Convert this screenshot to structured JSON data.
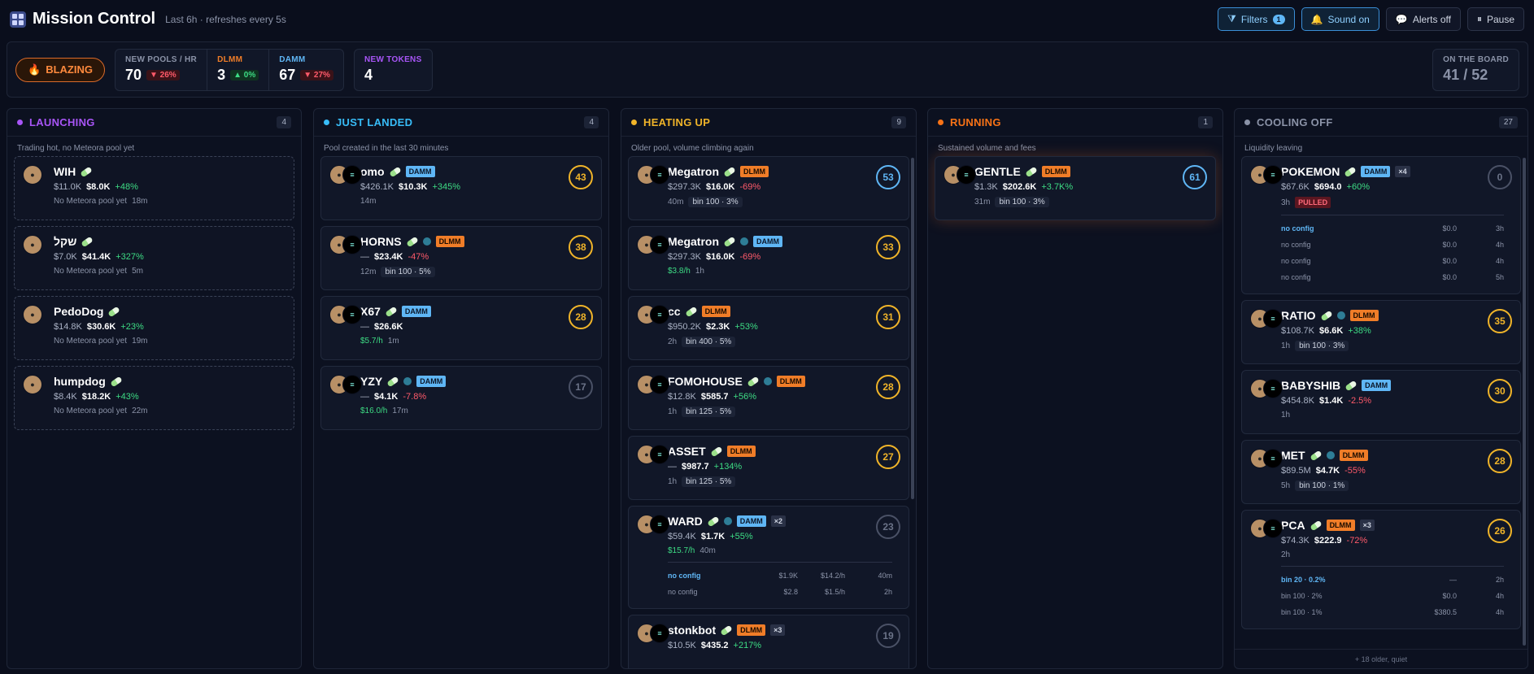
{
  "header": {
    "title": "Mission Control",
    "subtitle": "Last 6h · refreshes every 5s",
    "filters": "Filters",
    "filters_count": "1",
    "sound": "Sound on",
    "alerts": "Alerts off",
    "pause": "Pause"
  },
  "stats": {
    "status": "BLAZING",
    "pools_label": "NEW POOLS / HR",
    "pools_value": "70",
    "pools_delta": "▼ 26%",
    "dlmm_label": "DLMM",
    "dlmm_value": "3",
    "dlmm_delta": "▲ 0%",
    "damm_label": "DAMM",
    "damm_value": "67",
    "damm_delta": "▼ 27%",
    "tokens_label": "NEW TOKENS",
    "tokens_value": "4",
    "board_label": "ON THE BOARD",
    "board_value": "41 / 52"
  },
  "colors": {
    "launching": "#a855f7",
    "landed": "#38bdf8",
    "heating": "#f0b429",
    "running": "#f97316",
    "cooling": "#8b93a8"
  },
  "columns": [
    {
      "key": "launching",
      "title": "LAUNCHING",
      "count": "4",
      "desc": "Trading hot, no Meteora pool yet",
      "cards": [
        {
          "name": "WIH",
          "v1": "$11.0K",
          "v2": "$8.0K",
          "ch": "+48%",
          "meta": "No Meteora pool yet",
          "age": "18m"
        },
        {
          "name": "שקל",
          "v1": "$7.0K",
          "v2": "$41.4K",
          "ch": "+327%",
          "meta": "No Meteora pool yet",
          "age": "5m"
        },
        {
          "name": "PedoDog",
          "v1": "$14.8K",
          "v2": "$30.6K",
          "ch": "+23%",
          "meta": "No Meteora pool yet",
          "age": "19m"
        },
        {
          "name": "humpdog",
          "v1": "$8.4K",
          "v2": "$18.2K",
          "ch": "+43%",
          "meta": "No Meteora pool yet",
          "age": "22m"
        }
      ]
    },
    {
      "key": "landed",
      "title": "JUST LANDED",
      "count": "4",
      "desc": "Pool created in the last 30 minutes",
      "cards": [
        {
          "name": "omo",
          "badge": "DAMM",
          "v1": "$426.1K",
          "v2": "$10.3K",
          "ch": "+345%",
          "age": "14m",
          "score": "43"
        },
        {
          "name": "HORNS",
          "badge": "DLMM",
          "v1": "—",
          "v2": "$23.4K",
          "ch": "-47%",
          "age": "12m",
          "tag": "bin 100 · 5%",
          "score": "38"
        },
        {
          "name": "X67",
          "badge": "DAMM",
          "v1": "—",
          "v2": "$26.6K",
          "rate": "$5.7/h",
          "age": "1m",
          "score": "28"
        },
        {
          "name": "YZY",
          "badge": "DAMM",
          "v1": "—",
          "v2": "$4.1K",
          "ch": "-7.8%",
          "rate": "$16.0/h",
          "age": "17m",
          "score": "17"
        }
      ]
    },
    {
      "key": "heating",
      "title": "HEATING UP",
      "count": "9",
      "desc": "Older pool, volume climbing again",
      "cards": [
        {
          "name": "Megatron",
          "badge": "DLMM",
          "v1": "$297.3K",
          "v2": "$16.0K",
          "ch": "-69%",
          "age": "40m",
          "tag": "bin 100 · 3%",
          "score": "53"
        },
        {
          "name": "Megatron",
          "badge": "DAMM",
          "v1": "$297.3K",
          "v2": "$16.0K",
          "ch": "-69%",
          "rate": "$3.8/h",
          "age": "1h",
          "score": "33"
        },
        {
          "name": "cc",
          "badge": "DLMM",
          "v1": "$950.2K",
          "v2": "$2.3K",
          "ch": "+53%",
          "age": "2h",
          "tag": "bin 400 · 5%",
          "score": "31"
        },
        {
          "name": "FOMOHOUSE",
          "badge": "DLMM",
          "v1": "$12.8K",
          "v2": "$585.7",
          "ch": "+56%",
          "age": "1h",
          "tag": "bin 125 · 5%",
          "score": "28"
        },
        {
          "name": "ASSET",
          "badge": "DLMM",
          "v1": "—",
          "v2": "$987.7",
          "ch": "+134%",
          "age": "1h",
          "tag": "bin 125 · 5%",
          "score": "27"
        },
        {
          "name": "WARD",
          "badge": "DAMM",
          "mult": "×2",
          "v1": "$59.4K",
          "v2": "$1.7K",
          "ch": "+55%",
          "rate": "$15.7/h",
          "age": "40m",
          "score": "23",
          "pools": [
            [
              "no config",
              "$1.9K",
              "$14.2/h",
              "40m"
            ],
            [
              "no config",
              "$2.8",
              "$1.5/h",
              "2h"
            ]
          ]
        },
        {
          "name": "stonkbot",
          "badge": "DLMM",
          "mult": "×3",
          "v1": "$10.5K",
          "v2": "$435.2",
          "ch": "+217%",
          "score": "19"
        }
      ]
    },
    {
      "key": "running",
      "title": "RUNNING",
      "count": "1",
      "desc": "Sustained volume and fees",
      "cards": [
        {
          "name": "GENTLE",
          "badge": "DLMM",
          "v1": "$1.3K",
          "v2": "$202.6K",
          "ch": "+3.7K%",
          "age": "31m",
          "tag": "bin 100 · 3%",
          "score": "61"
        }
      ]
    },
    {
      "key": "cooling",
      "title": "COOLING OFF",
      "count": "27",
      "desc": "Liquidity leaving",
      "footer": "+ 18 older, quiet",
      "cards": [
        {
          "name": "POKEMON",
          "badge": "DAMM",
          "mult": "×4",
          "v1": "$67.6K",
          "v2": "$694.0",
          "ch": "+60%",
          "age": "3h",
          "pulled": "PULLED",
          "score": "0",
          "pools": [
            [
              "no config",
              "$0.0",
              "3h"
            ],
            [
              "no config",
              "$0.0",
              "4h"
            ],
            [
              "no config",
              "$0.0",
              "4h"
            ],
            [
              "no config",
              "$0.0",
              "5h"
            ]
          ]
        },
        {
          "name": "RATIO",
          "badge": "DLMM",
          "v1": "$108.7K",
          "v2": "$6.6K",
          "ch": "+38%",
          "age": "1h",
          "tag": "bin 100 · 3%",
          "score": "35"
        },
        {
          "name": "BABYSHIB",
          "badge": "DAMM",
          "v1": "$454.8K",
          "v2": "$1.4K",
          "ch": "-2.5%",
          "age": "1h",
          "score": "30"
        },
        {
          "name": "MET",
          "badge": "DLMM",
          "v1": "$89.5M",
          "v2": "$4.7K",
          "ch": "-55%",
          "age": "5h",
          "tag": "bin 100 · 1%",
          "score": "28"
        },
        {
          "name": "PCA",
          "badge": "DLMM",
          "mult": "×3",
          "v1": "$74.3K",
          "v2": "$222.9",
          "ch": "-72%",
          "age": "2h",
          "score": "26",
          "pools": [
            [
              "bin 20 · 0.2%",
              "—",
              "2h"
            ],
            [
              "bin 100 · 2%",
              "$0.0",
              "4h"
            ],
            [
              "bin 100 · 1%",
              "$380.5",
              "4h"
            ]
          ]
        }
      ]
    }
  ]
}
